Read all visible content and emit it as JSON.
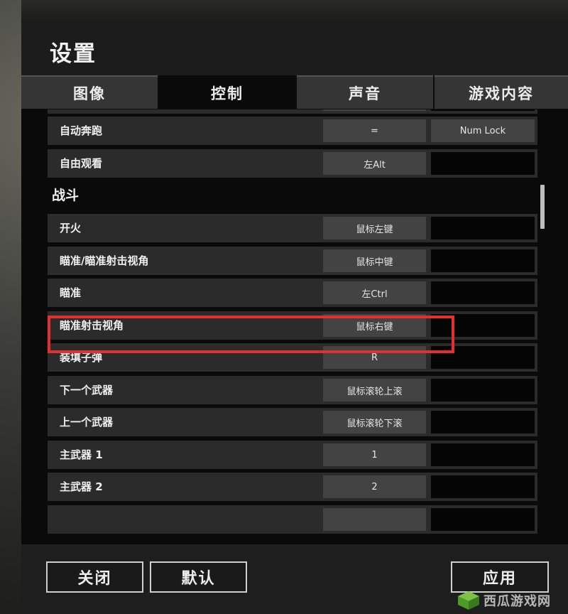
{
  "window": {
    "title": "设置"
  },
  "tabs": [
    {
      "label": "图像",
      "active": false
    },
    {
      "label": "控制",
      "active": true
    },
    {
      "label": "声音",
      "active": false
    },
    {
      "label": "游戏内容",
      "active": false
    }
  ],
  "bindings_general": [
    {
      "action": "自动奔跑",
      "key1": "=",
      "key2": "Num Lock"
    },
    {
      "action": "自由观看",
      "key1": "左Alt",
      "key2": ""
    }
  ],
  "section_combat": {
    "title": "战斗"
  },
  "bindings_combat": [
    {
      "action": "开火",
      "key1": "鼠标左键",
      "key2": ""
    },
    {
      "action": "瞄准/瞄准射击视角",
      "key1": "鼠标中键",
      "key2": ""
    },
    {
      "action": "瞄准",
      "key1": "左Ctrl",
      "key2": ""
    },
    {
      "action": "瞄准射击视角",
      "key1": "鼠标右键",
      "key2": ""
    },
    {
      "action": "装填子弹",
      "key1": "R",
      "key2": ""
    },
    {
      "action": "下一个武器",
      "key1": "鼠标滚轮上滚",
      "key2": ""
    },
    {
      "action": "上一个武器",
      "key1": "鼠标滚轮下滚",
      "key2": ""
    },
    {
      "action": "主武器 1",
      "key1": "1",
      "key2": ""
    },
    {
      "action": "主武器 2",
      "key1": "2",
      "key2": ""
    }
  ],
  "footer": {
    "close_label": "关闭",
    "default_label": "默认",
    "apply_label": "应用"
  },
  "highlight": {
    "color": "#e3302f"
  },
  "watermark": {
    "text": "西瓜游戏网"
  }
}
